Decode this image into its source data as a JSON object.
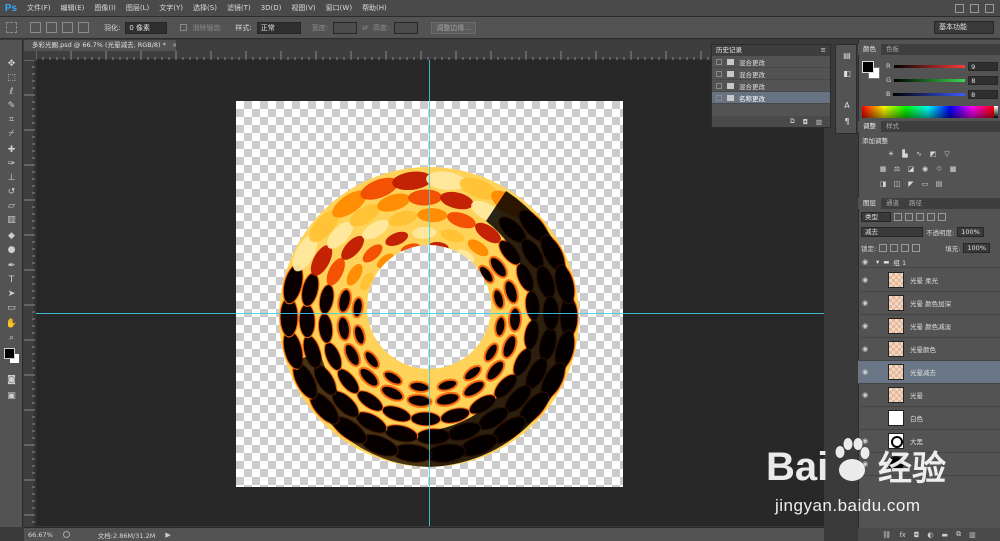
{
  "app": {
    "logo_text": "Ps",
    "menu": [
      "文件(F)",
      "编辑(E)",
      "图像(I)",
      "图层(L)",
      "文字(Y)",
      "选择(S)",
      "滤镜(T)",
      "3D(D)",
      "视图(V)",
      "窗口(W)",
      "帮助(H)"
    ],
    "workspace": "基本功能"
  },
  "options_bar": {
    "feather_label": "羽化:",
    "feather_value": "0 像素",
    "antialias_label": "消除锯齿",
    "style_label": "样式:",
    "style_value": "正常",
    "width_label": "宽度:",
    "height_label": "高度:",
    "refine_edge": "调整边缘..."
  },
  "document": {
    "tab_title": "多彩光圈.psd @ 66.7% (光晕减去, RGB/8) *",
    "close_glyph": "×"
  },
  "status_bar": {
    "zoom": "66.67%",
    "doc_info": "文档:2.86M/31.2M",
    "arrow": "▶"
  },
  "history_panel": {
    "title": "历史记录",
    "items": [
      {
        "label": "混合更改",
        "selected": false
      },
      {
        "label": "混合更改",
        "selected": false
      },
      {
        "label": "混合更改",
        "selected": false
      },
      {
        "label": "名称更改",
        "selected": true
      }
    ]
  },
  "color_panel": {
    "tabs": [
      "颜色",
      "色板"
    ],
    "channels": [
      {
        "name": "R",
        "value": "9",
        "color": "#ff3b3b"
      },
      {
        "name": "G",
        "value": "8",
        "color": "#3bd94a"
      },
      {
        "name": "B",
        "value": "8",
        "color": "#3b5bff"
      }
    ]
  },
  "adjustments_panel": {
    "tabs": [
      "调整",
      "样式"
    ],
    "title": "添加调整"
  },
  "layers_panel": {
    "tabs": [
      "图层",
      "通道",
      "路径"
    ],
    "filter_label": "类型",
    "blend_mode": "减去",
    "opacity_label": "不透明度:",
    "opacity_value": "100%",
    "lock_label": "锁定:",
    "fill_label": "填充:",
    "fill_value": "100%",
    "group_name": "组 1",
    "layers": [
      {
        "name": "光晕 柔光",
        "thumb": "checker",
        "selected": false
      },
      {
        "name": "光晕 颜色加深",
        "thumb": "checker",
        "selected": false
      },
      {
        "name": "光晕 颜色减淡",
        "thumb": "checker",
        "selected": false
      },
      {
        "name": "光晕颜色",
        "thumb": "checker",
        "selected": false
      },
      {
        "name": "光晕减去",
        "thumb": "checker",
        "selected": true
      },
      {
        "name": "光晕",
        "thumb": "checker",
        "selected": false
      },
      {
        "name": "白色",
        "thumb": "white",
        "selected": false
      },
      {
        "name": "大黑",
        "thumb": "ring",
        "selected": false
      },
      {
        "name": "",
        "thumb": "dark",
        "selected": false
      }
    ],
    "footer_icons": [
      "link-icon",
      "fx-icon",
      "mask-icon",
      "adjustment-icon",
      "folder-icon",
      "new-layer-icon",
      "trash-icon"
    ]
  },
  "watermark": {
    "brand": "Bai",
    "brand_cn": "经验",
    "url": "jingyan.baidu.com"
  },
  "accent": {
    "guide": "#3fd0e8",
    "selection": "#6a7585",
    "logo": "#31a8ff"
  }
}
